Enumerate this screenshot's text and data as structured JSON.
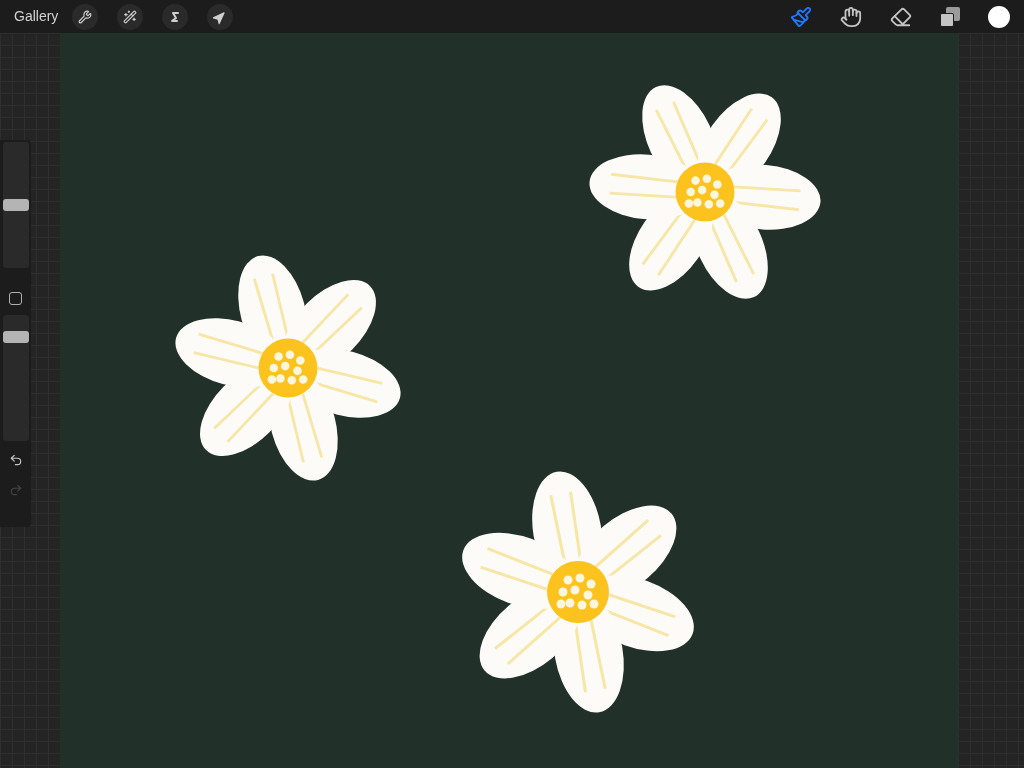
{
  "top_bar": {
    "gallery": "Gallery"
  },
  "paint_tools": [
    {
      "kind": "brush",
      "selected": true
    },
    {
      "kind": "smudge",
      "selected": false
    },
    {
      "kind": "eraser",
      "selected": false
    }
  ],
  "color_swatch": {
    "color": "#ffffff"
  },
  "sidebar": {
    "brush_size": {
      "level": 0.5
    },
    "opacity": {
      "level": 0.86
    },
    "undo": {
      "disabled": false
    },
    "redo": {
      "disabled": true
    }
  }
}
